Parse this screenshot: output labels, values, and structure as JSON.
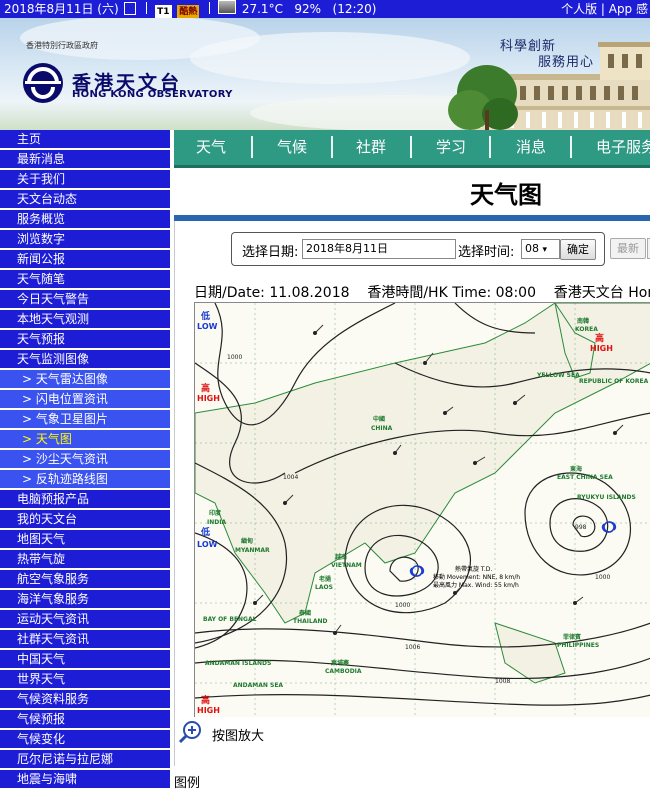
{
  "status_bar": {
    "date": "2018年8月11日 (六)",
    "badge_t1": "T1",
    "badge_hot": "酷熱",
    "temperature": "27.1°C",
    "humidity": "92%",
    "time": "(12:20)",
    "right_links": "个人版 | App 感"
  },
  "banner": {
    "gov_text": "香港特別行政區政府",
    "cn_name": "香港天文台",
    "en_name": "HONG KONG OBSERVATORY",
    "slogan_line1": "科學創新",
    "slogan_line2": "服務用心"
  },
  "nav": {
    "items": [
      {
        "label": "主页",
        "sub": false
      },
      {
        "label": "最新消息",
        "sub": false
      },
      {
        "label": "关于我们",
        "sub": false
      },
      {
        "label": "天文台动态",
        "sub": false
      },
      {
        "label": "服务概览",
        "sub": false
      },
      {
        "label": "浏览数字",
        "sub": false
      },
      {
        "label": "新闻公报",
        "sub": false
      },
      {
        "label": "天气随笔",
        "sub": false
      },
      {
        "label": "今日天气警告",
        "sub": false
      },
      {
        "label": "本地天气观测",
        "sub": false
      },
      {
        "label": "天气预报",
        "sub": false
      },
      {
        "label": "天气监测图像",
        "sub": false
      },
      {
        "label": "天气雷达图像",
        "sub": true
      },
      {
        "label": "闪电位置资讯",
        "sub": true
      },
      {
        "label": "气象卫星图片",
        "sub": true
      },
      {
        "label": "天气图",
        "sub": true,
        "active": true
      },
      {
        "label": "沙尘天气资讯",
        "sub": true
      },
      {
        "label": "反轨迹路线图",
        "sub": true
      },
      {
        "label": "电脑预报产品",
        "sub": false
      },
      {
        "label": "我的天文台",
        "sub": false
      },
      {
        "label": "地图天气",
        "sub": false
      },
      {
        "label": "热带气旋",
        "sub": false
      },
      {
        "label": "航空气象服务",
        "sub": false
      },
      {
        "label": "海洋气象服务",
        "sub": false
      },
      {
        "label": "运动天气资讯",
        "sub": false
      },
      {
        "label": "社群天气资讯",
        "sub": false
      },
      {
        "label": "中国天气",
        "sub": false
      },
      {
        "label": "世界天气",
        "sub": false
      },
      {
        "label": "气候资料服务",
        "sub": false
      },
      {
        "label": "气候预报",
        "sub": false
      },
      {
        "label": "气候变化",
        "sub": false
      },
      {
        "label": "厄尔尼诺与拉尼娜",
        "sub": false
      },
      {
        "label": "地震与海啸",
        "sub": false
      }
    ]
  },
  "menu": {
    "items": [
      "天气",
      "气候",
      "社群",
      "学习",
      "消息",
      "电子服务"
    ]
  },
  "page_title": "天气图",
  "selector": {
    "date_label": "选择日期:",
    "date_value": "2018年8月11日",
    "time_label": "选择时间:",
    "time_value": "08",
    "time_arrow": "▾",
    "confirm": "确定",
    "latest": "最新"
  },
  "map_header": {
    "date_text": "日期/Date: 11.08.2018",
    "time_text": "香港時間/HK Time: 08:00",
    "source_text": "香港天文台 Hong"
  },
  "map": {
    "pressure_labels": {
      "low_west": "低",
      "low_west_en": "LOW",
      "high_west": "高",
      "high_west_en": "HIGH",
      "low_india": "低",
      "low_india_en": "LOW",
      "high_sw": "高",
      "high_sw_en": "HIGH",
      "high_korea": "高",
      "high_korea_en": "HIGH"
    },
    "places": {
      "china": "CHINA",
      "china_cn": "中國",
      "korea": "KOREA",
      "korea_cn": "南韓",
      "republic_korea": "REPUBLIC OF KOREA",
      "yellow_sea": "YELLOW SEA",
      "east_china_sea": "EAST CHINA SEA",
      "east_china_sea_cn": "東海",
      "myanmar": "MYANMAR",
      "myanmar_cn": "緬甸",
      "india": "INDIA",
      "india_cn": "印度",
      "laos": "LAOS",
      "laos_cn": "老撾",
      "vietnam": "VIETNAM",
      "vietnam_cn": "越南",
      "thailand": "THAILAND",
      "thailand_cn": "泰國",
      "cambodia": "CAMBODIA",
      "cambodia_cn": "柬埔寨",
      "philippines": "PHILIPPINES",
      "philippines_cn": "菲律賓",
      "bay_of_bengal": "BAY OF BENGAL",
      "andaman_sea": "ANDAMAN SEA",
      "andaman_islands": "ANDAMAN ISLANDS",
      "ryukyu": "RYUKYU ISLANDS"
    },
    "storm_info": {
      "name": "熱帶氣旋 T.D.",
      "movement": "移動 Movement: NNE, 8 km/h",
      "wind": "最高風力 Max. Wind: 55 km/h"
    },
    "isobars": [
      "1000",
      "1002",
      "1004",
      "1006",
      "1008",
      "998"
    ]
  },
  "zoom_label": "按图放大",
  "legend_label": "图例",
  "colors": {
    "nav_blue": "#1d1dd6",
    "nav_sub_blue": "#3a52f0",
    "menu_green": "#2f9a84",
    "title_bar_blue": "#2a66b0",
    "map_pressure_red": "#d11",
    "map_low_blue": "#1a3ad1"
  }
}
